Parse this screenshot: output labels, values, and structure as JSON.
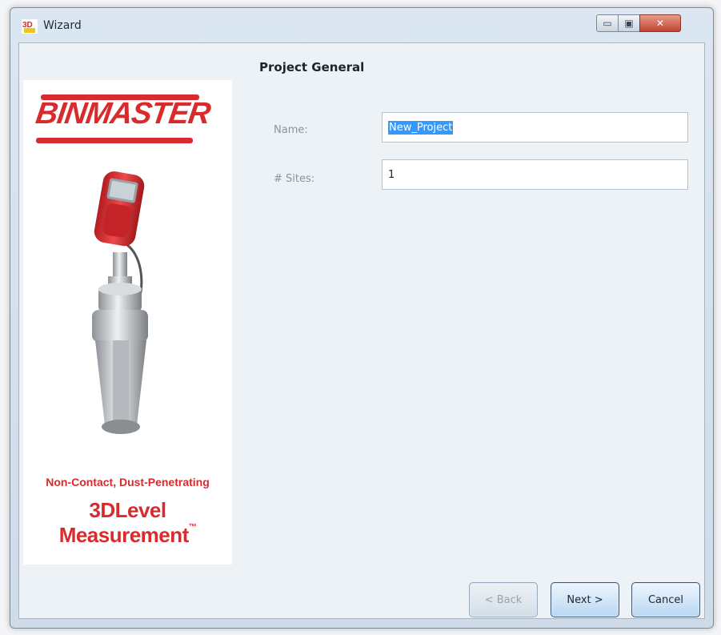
{
  "window": {
    "title": "Wizard",
    "controls": {
      "minimize_icon": "minimize-icon",
      "maximize_icon": "maximize-icon",
      "close_icon": "close-icon"
    }
  },
  "branding": {
    "logo_text": "BINMASTER",
    "tagline_line1": "Non-Contact, Dust-Penetrating",
    "tagline_line2": "3DLevel Measurement",
    "tagline_mark": "™",
    "brand_color": "#d82b2d"
  },
  "form": {
    "section_title": "Project General",
    "name_label": "Name:",
    "name_value": "New_Project",
    "sites_label": "# Sites:",
    "sites_value": "1"
  },
  "buttons": {
    "back": "< Back",
    "next": "Next >",
    "cancel": "Cancel"
  }
}
